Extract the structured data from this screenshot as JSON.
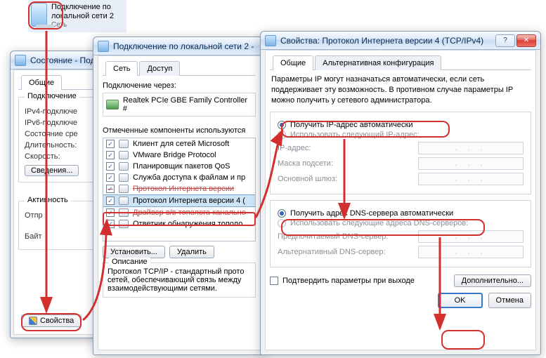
{
  "desktop": {
    "title": "Подключение по локальной сети 2",
    "sub": "Сеть"
  },
  "statusWin": {
    "title": "Состояние - Под",
    "tab": "Общие",
    "group_conn": "Подключение",
    "l_ipv4": "IPv4-подключе",
    "l_ipv6": "IPv6-подключе",
    "l_media": "Состояние сре",
    "l_dur": "Длительность:",
    "l_speed": "Скорость:",
    "btn_details": "Сведения...",
    "group_act": "Активность",
    "l_sent": "Отпр",
    "l_bytes": "Байт",
    "btn_props": "Свойства"
  },
  "adapterWin": {
    "title": "Подключение по локальной сети 2 -",
    "tabs": [
      "Сеть",
      "Доступ"
    ],
    "lbl_through": "Подключение через:",
    "nic": "Realtek PCIe GBE Family Controller #",
    "lbl_components": "Отмеченные компоненты используются",
    "components": [
      "Клиент для сетей Microsoft",
      "VMware Bridge Protocol",
      "Планировщик пакетов QoS",
      "Служба доступа к файлам и пр",
      "Протокол Интернета версии",
      "Протокол Интернета версии 4 (",
      "Драйвер в/в тополога канально",
      "Ответчик обнаружения тополо"
    ],
    "btn_install": "Установить...",
    "btn_remove": "Удалить",
    "desc_label": "Описание",
    "desc_text": "Протокол TCP/IP - стандартный прото\nсетей, обеспечивающий связь между\nвзаимодействующими сетями."
  },
  "tcpWin": {
    "title": "Свойства: Протокол Интернета версии 4 (TCP/IPv4)",
    "tabs": [
      "Общие",
      "Альтернативная конфигурация"
    ],
    "intro": "Параметры IP могут назначаться автоматически, если сеть поддерживает эту возможность. В противном случае параметры IP можно получить у сетевого администратора.",
    "r_ip_auto": "Получить IP-адрес автоматически",
    "r_ip_manual": "Использовать следующий IP-адрес:",
    "f_ip": "IP-адрес:",
    "f_mask": "Маска подсети:",
    "f_gw": "Основной шлюз:",
    "r_dns_auto": "Получить адрес DNS-сервера автоматически",
    "r_dns_manual": "Использовать следующие адреса DNS-серверов:",
    "f_dns1": "Предпочитаемый DNS-сервер:",
    "f_dns2": "Альтернативный DNS-сервер:",
    "chk_validate": "Подтвердить параметры при выходе",
    "btn_adv": "Дополнительно...",
    "btn_ok": "OK",
    "btn_cancel": "Отмена"
  },
  "ipdots": ". . ."
}
